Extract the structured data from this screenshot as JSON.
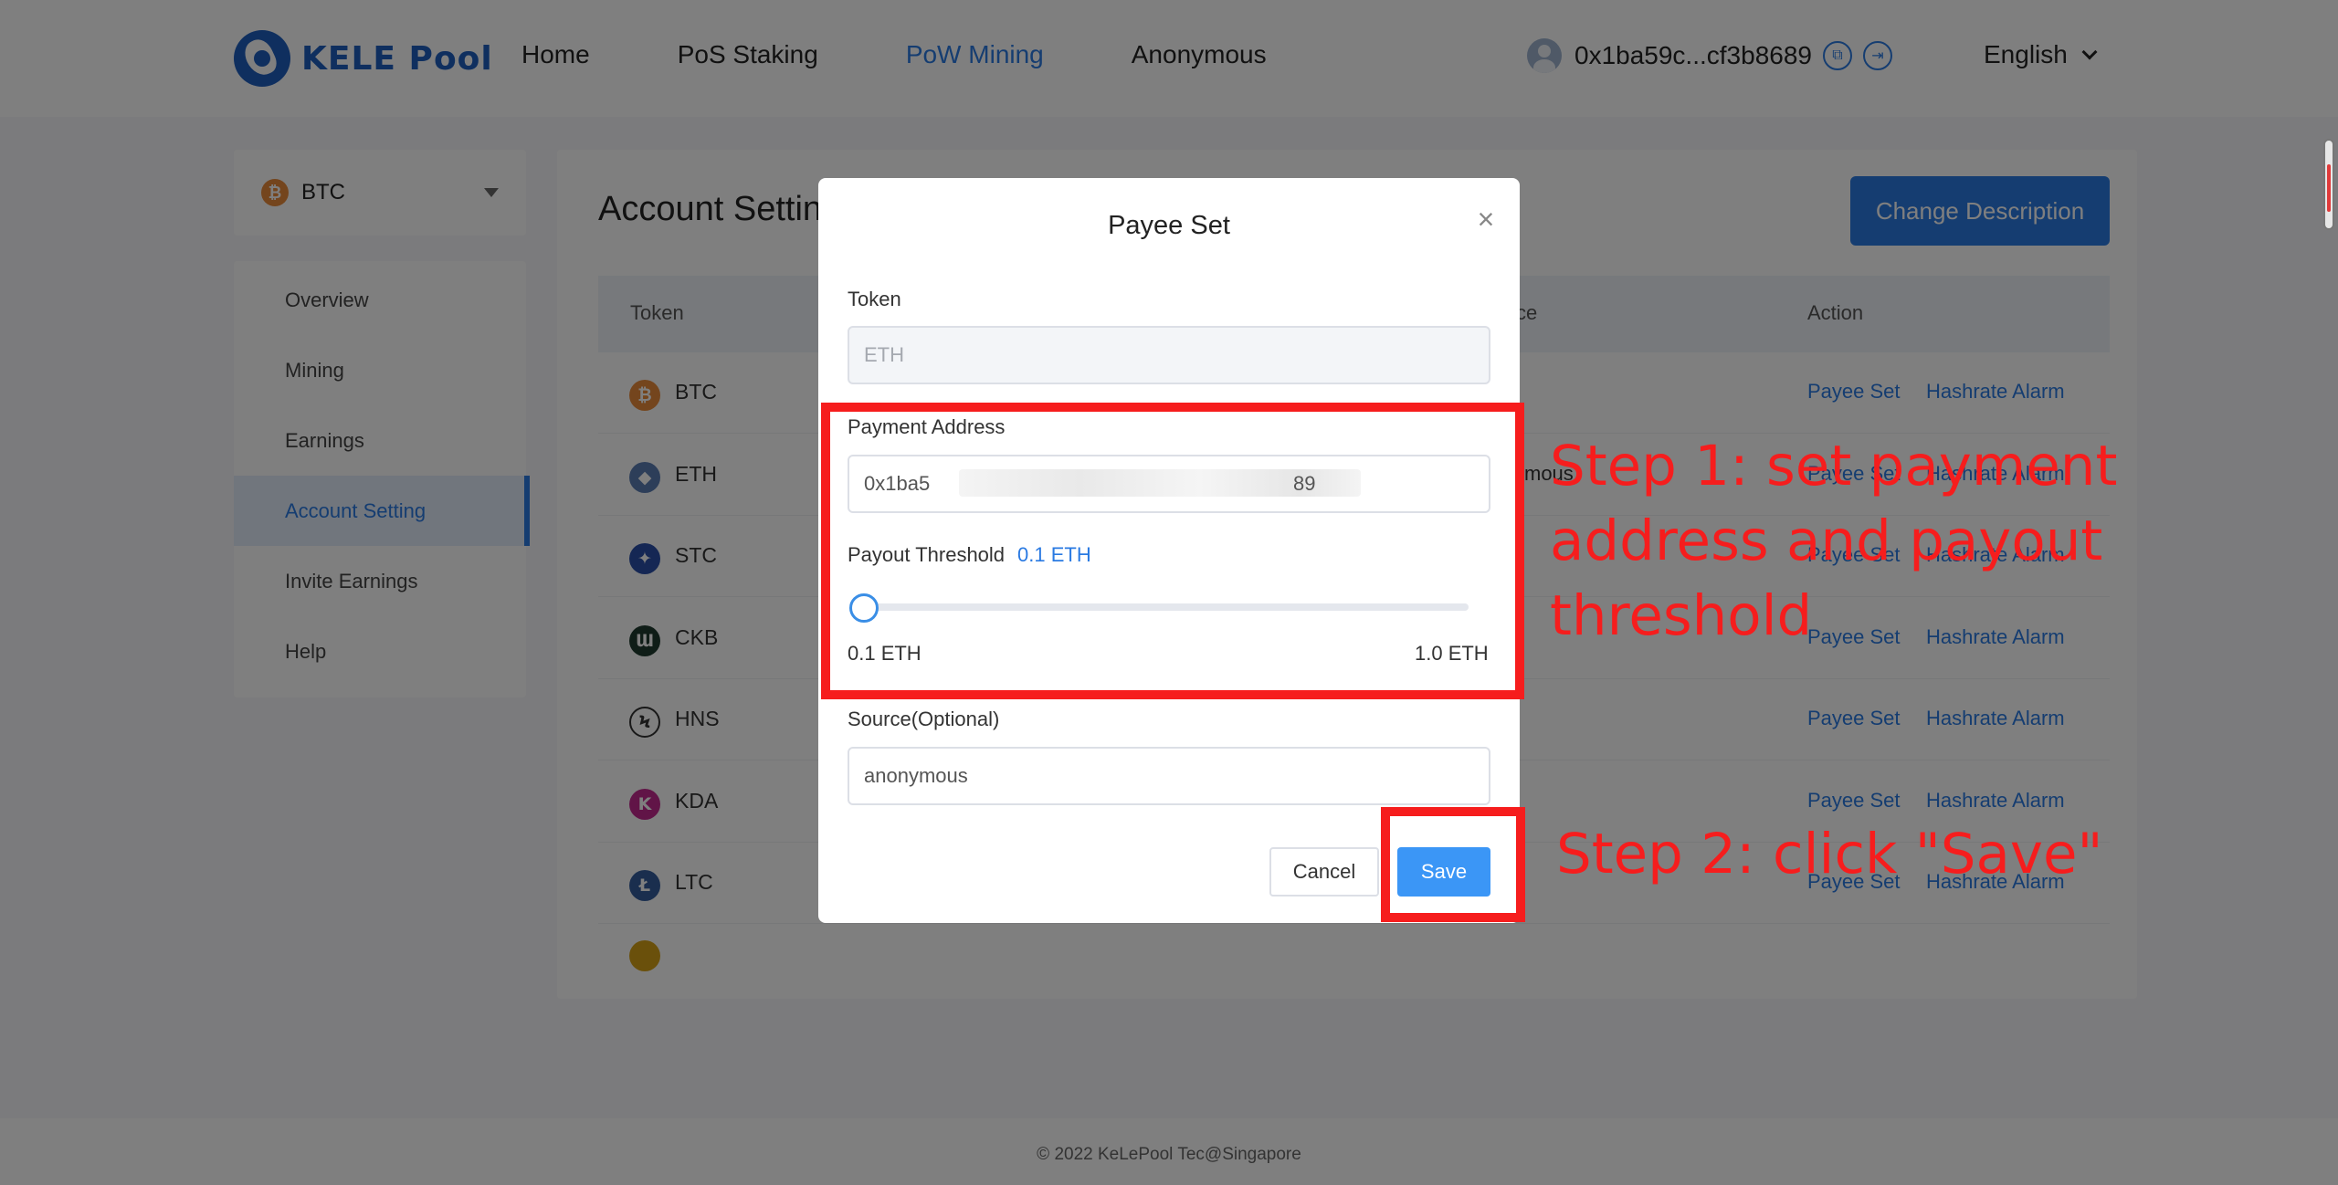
{
  "header": {
    "logo_text": "KELE Pool",
    "nav": [
      {
        "label": "Home",
        "active": false
      },
      {
        "label": "PoS Staking",
        "active": false
      },
      {
        "label": "PoW Mining",
        "active": true
      },
      {
        "label": "Anonymous",
        "active": false
      }
    ],
    "wallet_address": "0x1ba59c...cf3b8689",
    "language": "English"
  },
  "sidebar": {
    "token": "BTC",
    "menu": [
      {
        "label": "Overview",
        "active": false
      },
      {
        "label": "Mining",
        "active": false
      },
      {
        "label": "Earnings",
        "active": false
      },
      {
        "label": "Account Setting",
        "active": true
      },
      {
        "label": "Invite Earnings",
        "active": false
      },
      {
        "label": "Help",
        "active": false
      }
    ]
  },
  "main": {
    "title": "Account Setting",
    "change_description_label": "Change Description",
    "columns": {
      "token": "Token",
      "source_partial": "ce",
      "action": "Action"
    },
    "rows": [
      {
        "token": "BTC",
        "icon": "btc-icon",
        "color": "#e88a3a",
        "glyph": "₿",
        "source": ""
      },
      {
        "token": "ETH",
        "icon": "eth-icon",
        "color": "#5b7db3",
        "glyph": "◆",
        "source": "ymous"
      },
      {
        "token": "STC",
        "icon": "stc-icon",
        "color": "#2a4fa8",
        "glyph": "✦",
        "source": ""
      },
      {
        "token": "CKB",
        "icon": "ckb-icon",
        "color": "#1f3b2f",
        "glyph": "Ɯ",
        "source": ""
      },
      {
        "token": "HNS",
        "icon": "hns-icon",
        "color": "#ffffff",
        "glyph": "Ϟ",
        "source": ""
      },
      {
        "token": "KDA",
        "icon": "kda-icon",
        "color": "#c2298f",
        "glyph": "K",
        "source": ""
      },
      {
        "token": "LTC",
        "icon": "ltc-icon",
        "color": "#345d9d",
        "glyph": "Ł",
        "source": ""
      }
    ],
    "action_payee": "Payee Set",
    "action_alarm": "Hashrate Alarm"
  },
  "footer": {
    "copyright": "© 2022 KeLePool Tec@Singapore"
  },
  "modal": {
    "title": "Payee Set",
    "close_glyph": "×",
    "token_label": "Token",
    "token_value": "ETH",
    "payment_label": "Payment Address",
    "payment_value_start": "0x1ba5",
    "payment_value_end": "89",
    "threshold_label": "Payout Threshold",
    "threshold_value": "0.1  ETH",
    "threshold_min_label": "0.1 ETH",
    "threshold_max_label": "1.0 ETH",
    "threshold_level": 0,
    "source_label": "Source(Optional)",
    "source_value": "anonymous",
    "cancel_label": "Cancel",
    "save_label": "Save"
  },
  "annotations": {
    "step1": "Step 1: set payment address and payout threshold",
    "step2": "Step 2: click \"Save\"",
    "color": "#f61d1d"
  }
}
